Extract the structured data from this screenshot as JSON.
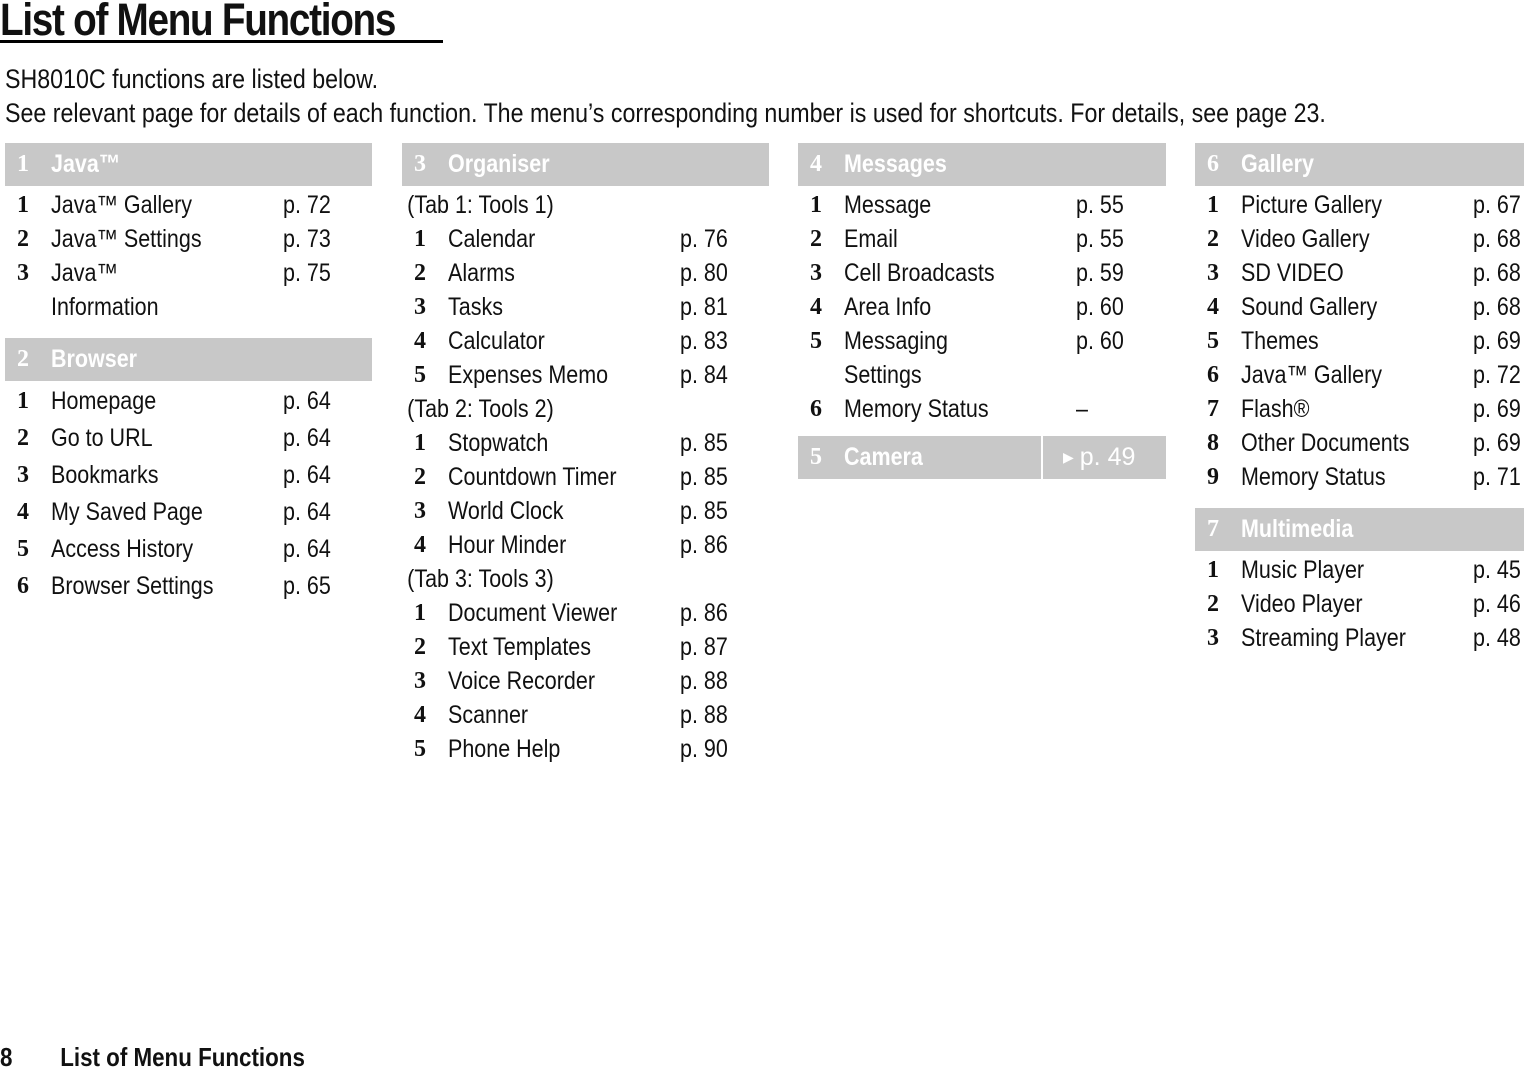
{
  "page": {
    "title": "List of Menu Functions",
    "intro": [
      "SH8010C functions are listed below.",
      "See relevant page for details of each function. The menu’s corresponding number is used for shortcuts. For details, see page 23."
    ],
    "footer": {
      "page_number": "8",
      "label": "List of Menu Functions"
    }
  },
  "colors": {
    "section_header_bg": "#c8c8c8",
    "section_header_text": "#ffffff"
  },
  "sections": {
    "java": {
      "num": "1",
      "label": "Java™",
      "items": [
        {
          "n": "1",
          "label": "Java™ Gallery",
          "page": "p. 72"
        },
        {
          "n": "2",
          "label": "Java™ Settings",
          "page": "p. 73"
        },
        {
          "n": "3",
          "label": "Java™\nInformation",
          "page": "p. 75"
        }
      ]
    },
    "browser": {
      "num": "2",
      "label": "Browser",
      "items": [
        {
          "n": "1",
          "label": "Homepage",
          "page": "p. 64"
        },
        {
          "n": "2",
          "label": "Go to URL",
          "page": "p. 64"
        },
        {
          "n": "3",
          "label": "Bookmarks",
          "page": "p. 64"
        },
        {
          "n": "4",
          "label": "My Saved Page",
          "page": "p. 64"
        },
        {
          "n": "5",
          "label": "Access History",
          "page": "p. 64"
        },
        {
          "n": "6",
          "label": "Browser Settings",
          "page": "p. 65"
        }
      ]
    },
    "organiser": {
      "num": "3",
      "label": "Organiser",
      "groups": [
        {
          "title": "(Tab 1: Tools 1)",
          "items": [
            {
              "n": "1",
              "label": "Calendar",
              "page": "p. 76"
            },
            {
              "n": "2",
              "label": "Alarms",
              "page": "p. 80"
            },
            {
              "n": "3",
              "label": "Tasks",
              "page": "p. 81"
            },
            {
              "n": "4",
              "label": "Calculator",
              "page": "p. 83"
            },
            {
              "n": "5",
              "label": "Expenses Memo",
              "page": "p. 84"
            }
          ]
        },
        {
          "title": "(Tab 2: Tools 2)",
          "items": [
            {
              "n": "1",
              "label": "Stopwatch",
              "page": "p. 85"
            },
            {
              "n": "2",
              "label": "Countdown Timer",
              "page": "p. 85"
            },
            {
              "n": "3",
              "label": "World Clock",
              "page": "p. 85"
            },
            {
              "n": "4",
              "label": "Hour Minder",
              "page": "p. 86"
            }
          ]
        },
        {
          "title": "(Tab 3: Tools 3)",
          "items": [
            {
              "n": "1",
              "label": "Document Viewer",
              "page": "p. 86"
            },
            {
              "n": "2",
              "label": "Text Templates",
              "page": "p. 87"
            },
            {
              "n": "3",
              "label": "Voice Recorder",
              "page": "p. 88"
            },
            {
              "n": "4",
              "label": "Scanner",
              "page": "p. 88"
            },
            {
              "n": "5",
              "label": "Phone Help",
              "page": "p. 90"
            }
          ]
        }
      ]
    },
    "messages": {
      "num": "4",
      "label": "Messages",
      "items": [
        {
          "n": "1",
          "label": "Message",
          "page": "p. 55"
        },
        {
          "n": "2",
          "label": "Email",
          "page": "p. 55"
        },
        {
          "n": "3",
          "label": "Cell Broadcasts",
          "page": "p. 59"
        },
        {
          "n": "4",
          "label": "Area Info",
          "page": "p. 60"
        },
        {
          "n": "5",
          "label": "Messaging\nSettings",
          "page": "p. 60"
        },
        {
          "n": "6",
          "label": "Memory Status",
          "page": "–"
        }
      ]
    },
    "camera": {
      "num": "5",
      "label": "Camera",
      "page": "p. 49",
      "arrow_icon": "triangle-right-icon"
    },
    "gallery": {
      "num": "6",
      "label": "Gallery",
      "items": [
        {
          "n": "1",
          "label": "Picture Gallery",
          "page": "p. 67"
        },
        {
          "n": "2",
          "label": "Video Gallery",
          "page": "p. 68"
        },
        {
          "n": "3",
          "label": "SD VIDEO",
          "page": "p. 68"
        },
        {
          "n": "4",
          "label": "Sound Gallery",
          "page": "p. 68"
        },
        {
          "n": "5",
          "label": "Themes",
          "page": "p. 69"
        },
        {
          "n": "6",
          "label": "Java™ Gallery",
          "page": "p. 72"
        },
        {
          "n": "7",
          "label": "Flash®",
          "page": "p. 69"
        },
        {
          "n": "8",
          "label": "Other Documents",
          "page": "p. 69"
        },
        {
          "n": "9",
          "label": "Memory Status",
          "page": "p. 71"
        }
      ]
    },
    "multimedia": {
      "num": "7",
      "label": "Multimedia",
      "items": [
        {
          "n": "1",
          "label": "Music Player",
          "page": "p. 45"
        },
        {
          "n": "2",
          "label": "Video Player",
          "page": "p. 46"
        },
        {
          "n": "3",
          "label": "Streaming Player",
          "page": "p. 48"
        }
      ]
    }
  }
}
